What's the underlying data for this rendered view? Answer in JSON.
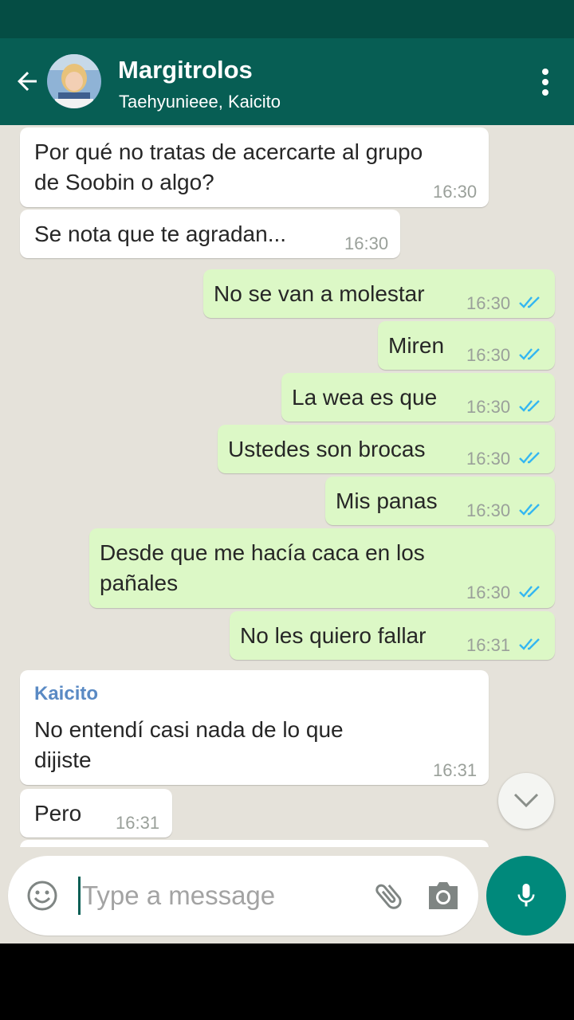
{
  "header": {
    "title": "Margitrolos",
    "subtitle": "Taehyunieee, Kaicito"
  },
  "colors": {
    "header": "#075e54",
    "status_bar": "#054d44",
    "incoming_bubble": "#ffffff",
    "outgoing_bubble": "#dcf8c6",
    "read_ticks": "#34b7f1",
    "accent": "#00897b",
    "sender_name": "#5a8ac4"
  },
  "messages": [
    {
      "direction": "in",
      "lines": [
        "Por qué no tratas de acercarte al grupo",
        "de Soobin o algo?"
      ],
      "time": "16:30"
    },
    {
      "direction": "in",
      "lines": [
        "Se nota que te agradan..."
      ],
      "time": "16:30"
    },
    {
      "direction": "out",
      "lines": [
        "No se van a molestar"
      ],
      "time": "16:30",
      "status": "read"
    },
    {
      "direction": "out",
      "lines": [
        "Miren"
      ],
      "time": "16:30",
      "status": "read"
    },
    {
      "direction": "out",
      "lines": [
        "La wea es que"
      ],
      "time": "16:30",
      "status": "read"
    },
    {
      "direction": "out",
      "lines": [
        "Ustedes son brocas"
      ],
      "time": "16:30",
      "status": "read"
    },
    {
      "direction": "out",
      "lines": [
        "Mis panas"
      ],
      "time": "16:30",
      "status": "read"
    },
    {
      "direction": "out",
      "lines": [
        "Desde que me hacía caca en los",
        "pañales"
      ],
      "time": "16:30",
      "status": "read"
    },
    {
      "direction": "out",
      "lines": [
        "No les quiero fallar"
      ],
      "time": "16:31",
      "status": "read"
    },
    {
      "direction": "in",
      "sender": "Kaicito",
      "lines": [
        "No entendí casi nada de lo que",
        "dijiste"
      ],
      "time": "16:31"
    },
    {
      "direction": "in",
      "lines": [
        "Pero"
      ],
      "time": "16:31"
    }
  ],
  "composer": {
    "placeholder": "Type a message",
    "value": ""
  },
  "icons": {
    "back": "arrow-left-icon",
    "menu": "more-vert-icon",
    "emoji": "emoji-icon",
    "attach": "paperclip-icon",
    "camera": "camera-icon",
    "mic": "mic-icon",
    "scroll_down": "chevron-down-icon",
    "read_receipt": "double-check-icon"
  }
}
